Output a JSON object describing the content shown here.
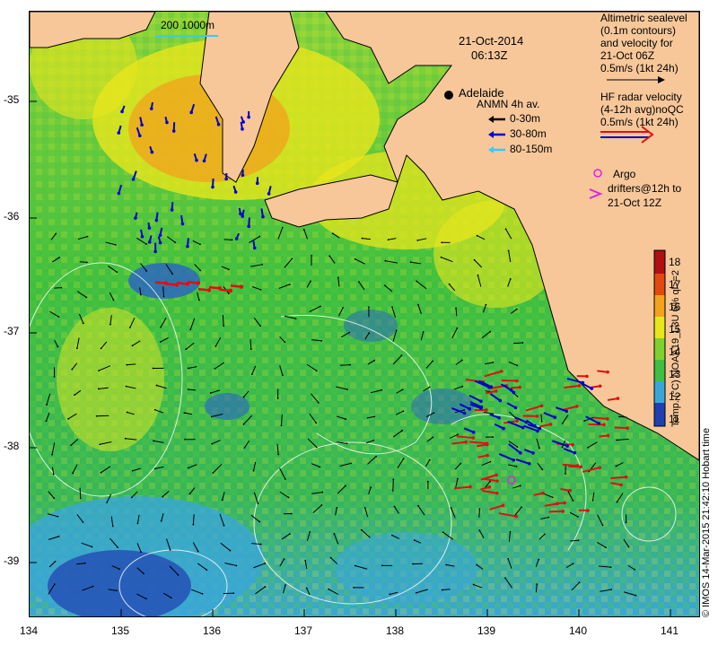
{
  "map": {
    "timestamp_date": "21-Oct-2014",
    "timestamp_time": "06:13Z",
    "depth_legend": "200  1000m",
    "place_label": "Adelaide",
    "anmn_title": "ANMN 4h av.",
    "anmn_items": [
      {
        "label": "0-30m",
        "color": "#000000"
      },
      {
        "label": "30-80m",
        "color": "#0000cc"
      },
      {
        "label": "80-150m",
        "color": "#33ccff"
      }
    ],
    "altimetry_legend": [
      "Altimetric sealevel",
      "(0.1m contours)",
      "and velocity for",
      "21-Oct 06Z",
      "0.5m/s (1kt 24h)"
    ],
    "hf_legend": [
      "HF radar velocity",
      "(4-12h avg)noQC",
      "0.5m/s (1kt 24h)"
    ],
    "argo_legend": [
      "Argo",
      "drifters@12h to",
      "21-Oct 12Z"
    ],
    "colorbar_label": "Temp. (°C) NOAA19_L3U 6% ql>=2",
    "colorbar_ticks": [
      "18",
      "17",
      "16",
      "15",
      "14",
      "13",
      "12",
      "11"
    ],
    "credit": "© IMOS 14-Mar-2015 21:42:10 Hobart time",
    "x_ticks": [
      "134",
      "135",
      "136",
      "137",
      "138",
      "139",
      "140",
      "141"
    ],
    "y_ticks": [
      "-35",
      "-36",
      "-37",
      "-38",
      "-39"
    ],
    "colors": {
      "land": "#f7c79a",
      "warm_sst": "#f2a21c",
      "mid_sst": "#e8e61c",
      "cool_sst": "#3fbf3f",
      "cold_sst": "#3aa6d8",
      "deep_cold": "#1f3fb0"
    }
  }
}
